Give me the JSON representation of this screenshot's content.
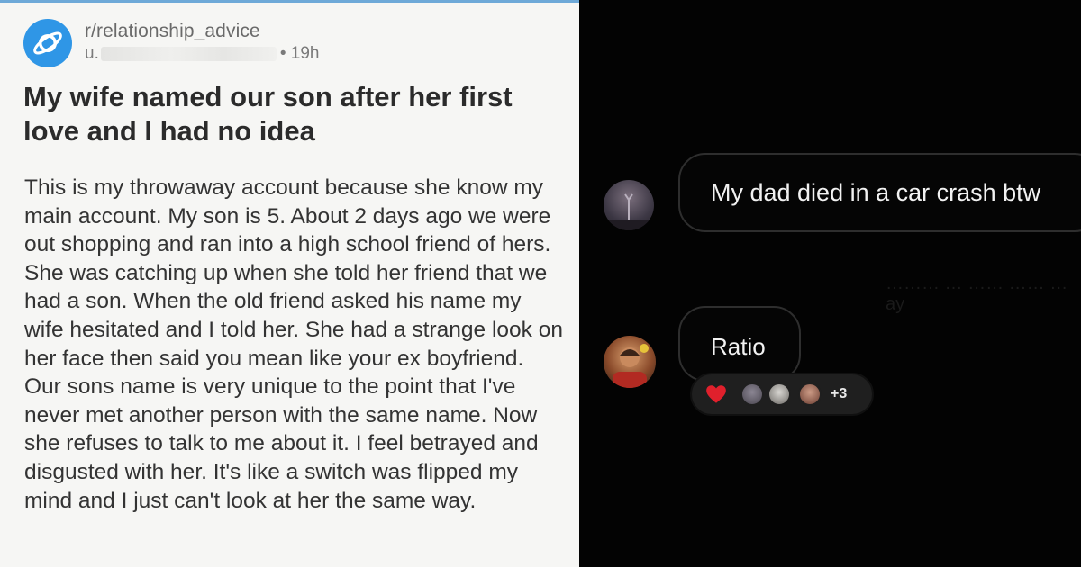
{
  "post": {
    "subreddit": "r/relationship_advice",
    "user_prefix": "u.",
    "age": "• 19h",
    "title": "My wife named our son after her first love and I had no idea",
    "body": "This is my throwaway account because she know my main account. My son is 5. About 2 days ago we were out shopping and ran into a high school friend of hers. She was catching up when she told her friend that we had a son. When the old friend asked his name my wife hesitated and I told her. She had a strange look on her face then said you mean like your ex boyfriend. Our sons name is very unique to the point that I've never met another person with the same name. Now she refuses to talk to me about it. I feel betrayed and disgusted with her. It's like a switch was flipped my mind and I just can't look at her the same way."
  },
  "thread": {
    "comment_1": {
      "text": "My dad died in a car crash btw"
    },
    "ghost_text": "……… … …… …… …ay",
    "comment_2": {
      "text": "Ratio"
    },
    "reactions": {
      "emoji_icon": "heart-icon",
      "extra_count": "+3"
    }
  },
  "colors": {
    "reddit_blue": "#2f96e6",
    "heart_red": "#e0202c"
  }
}
